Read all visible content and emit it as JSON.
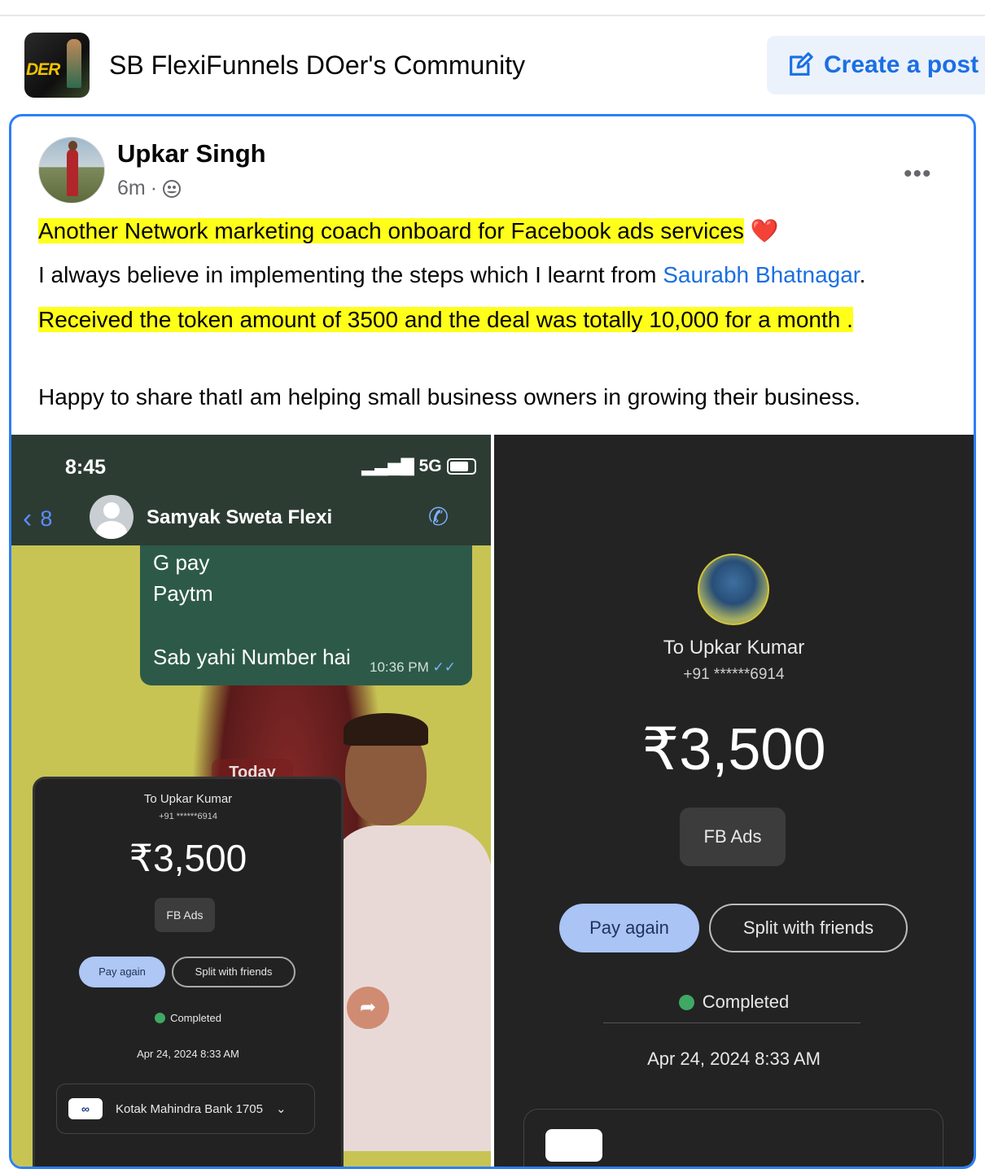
{
  "header": {
    "group_logo_text": "DER",
    "group_title": "SB FlexiFunnels DOer's Community",
    "create_post_label": "Create a post"
  },
  "post": {
    "author": "Upkar Singh",
    "time": "6m",
    "audience_icon": "globe-icon",
    "more_label": "•••",
    "lines": {
      "line1": "Another Network marketing coach onboard for Facebook ads services",
      "line1_emoji": "❤️",
      "line2_before": "I always believe in implementing the steps which I learnt from ",
      "line2_mention": "Saurabh Bhatnagar",
      "line2_after": ".",
      "line3": "Received the token amount of 3500 and the deal was totally 10,000 for a month .",
      "line4": "Happy to share thatI am helping small business owners in growing their business."
    },
    "colors": {
      "highlight": "#ffff1a",
      "mention": "#1b6fe2",
      "accent": "#2d7ef7"
    }
  },
  "left_image": {
    "status_time": "8:45",
    "network": "5G",
    "back_count": "8",
    "contact_name": "Samyak Sweta Flexi",
    "message": {
      "line1": "G pay",
      "line2": "Paytm",
      "line3": "Sab yahi Number hai",
      "time": "10:36 PM"
    },
    "date_separator": "Today",
    "receipt": {
      "to": "To Upkar Kumar",
      "phone": "+91 ******6914",
      "amount": "₹3,500",
      "note": "FB Ads",
      "pay_again": "Pay again",
      "split": "Split with friends",
      "status": "Completed",
      "date": "Apr 24, 2024 8:33 AM",
      "bank": "Kotak Mahindra Bank 1705"
    }
  },
  "right_image": {
    "to": "To Upkar Kumar",
    "phone": "+91 ******6914",
    "amount": "₹3,500",
    "note": "FB Ads",
    "pay_again": "Pay again",
    "split": "Split with friends",
    "status": "Completed",
    "date": "Apr 24, 2024 8:33 AM"
  }
}
